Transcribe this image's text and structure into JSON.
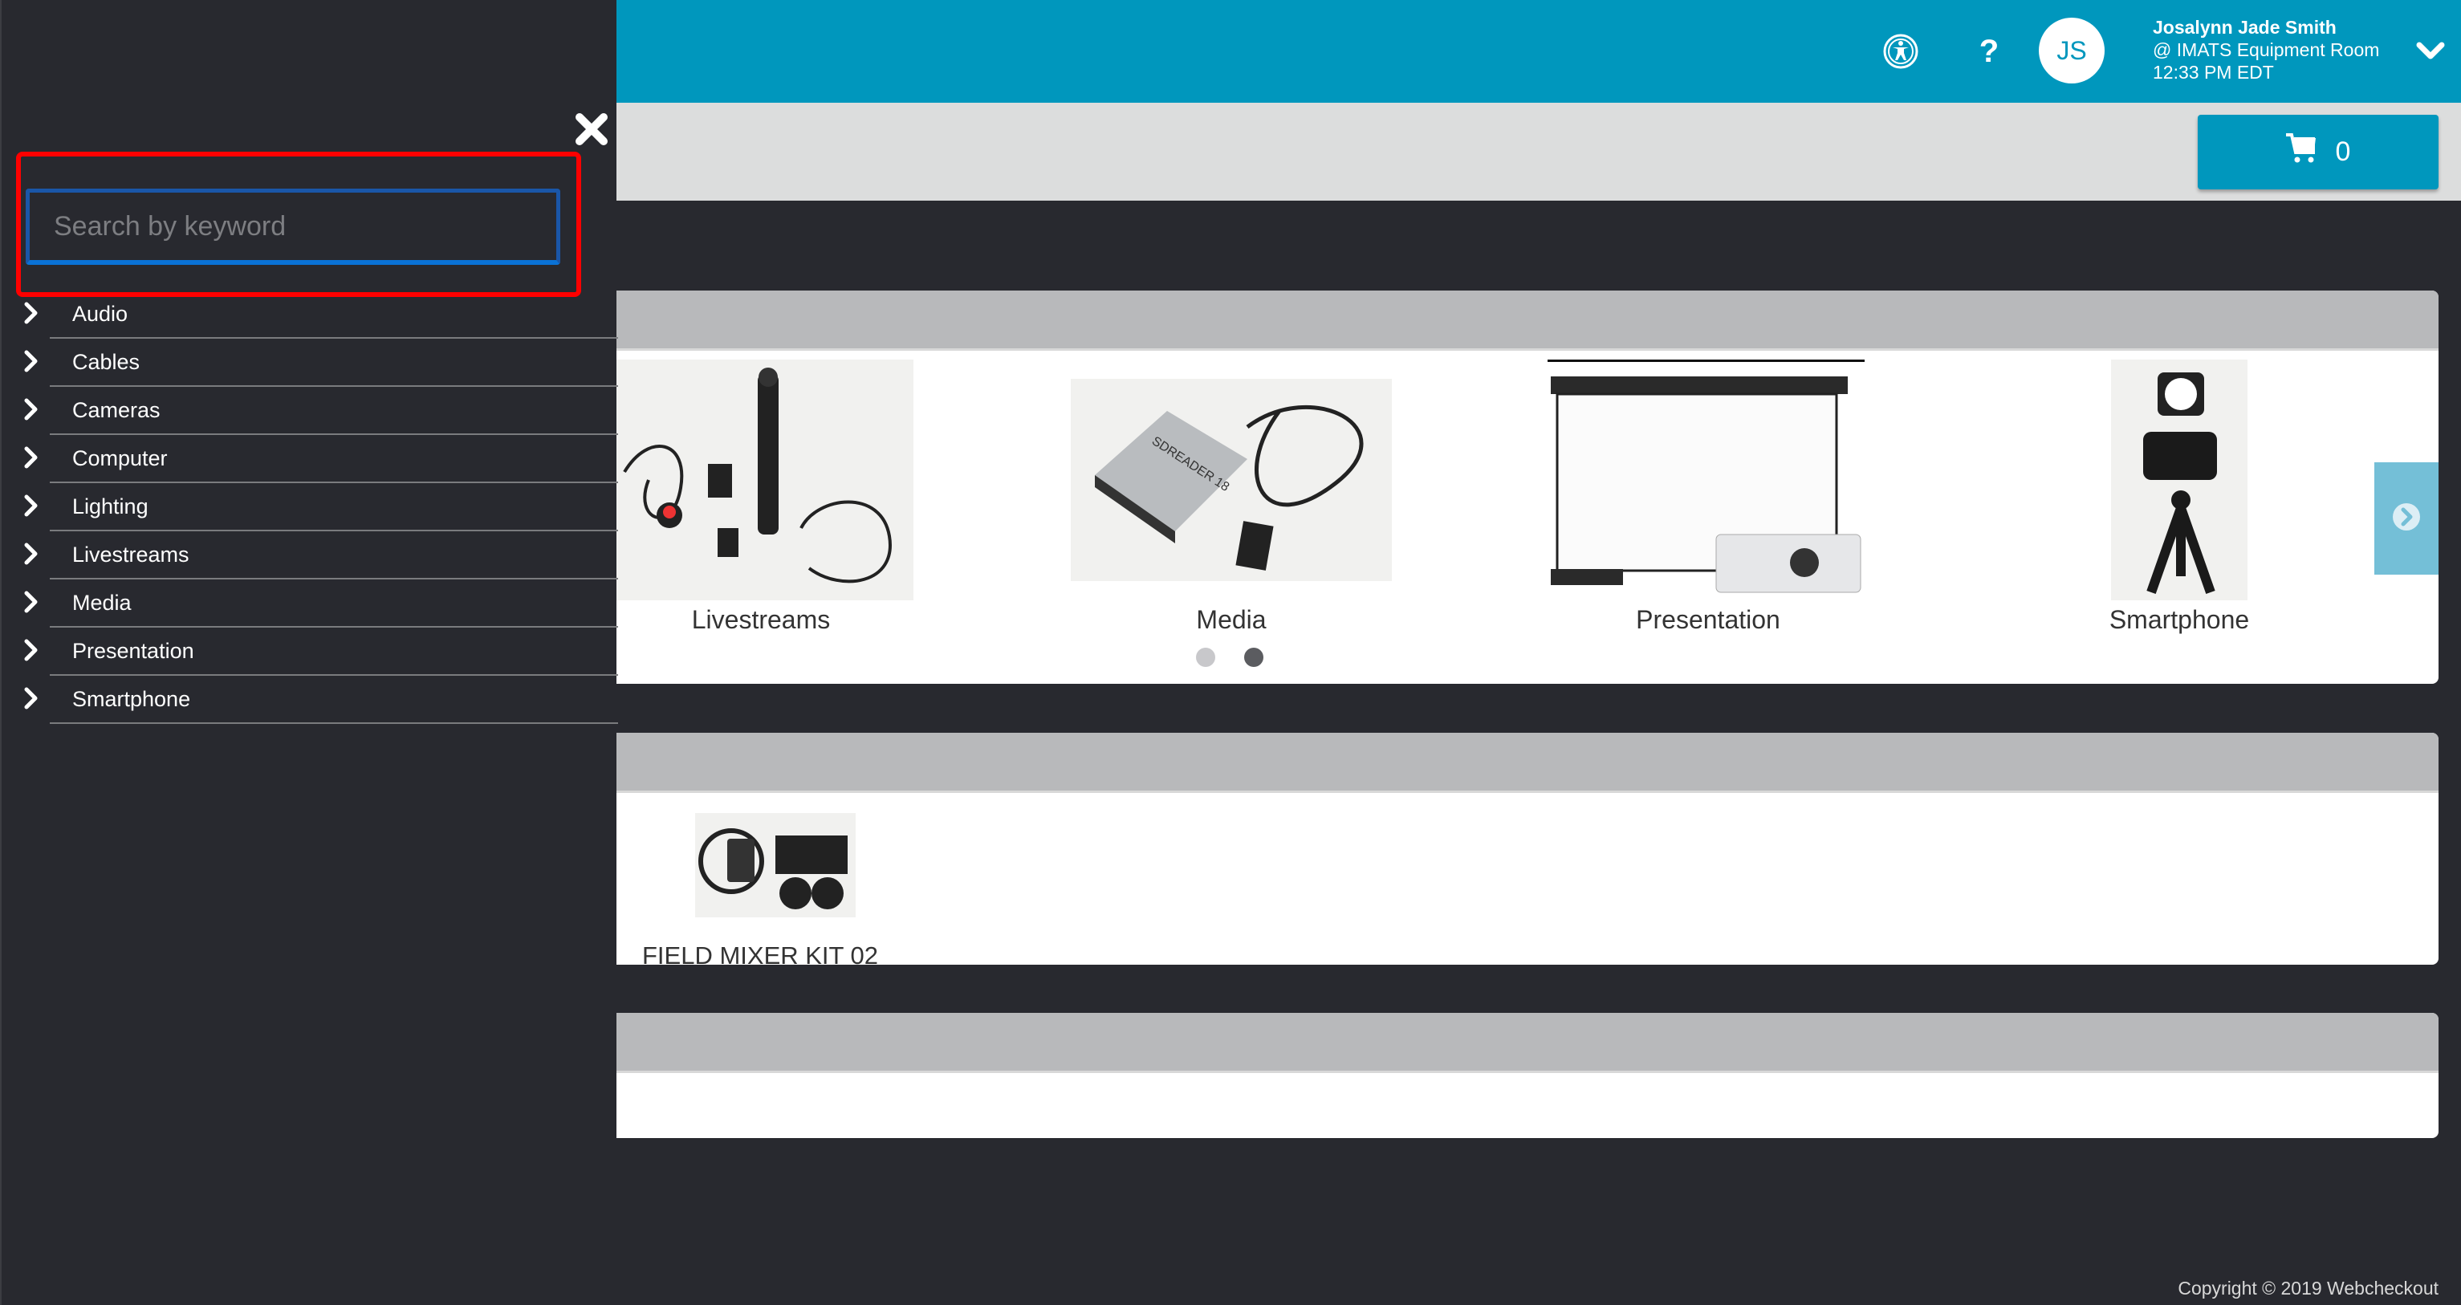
{
  "header": {
    "accessibility_icon": "accessibility-icon",
    "help_label": "?",
    "avatar_initials": "JS",
    "user_name": "Josalynn Jade Smith",
    "location": "@ IMATS Equipment Room",
    "time": "12:33 PM EDT",
    "brand_color": "#0097bd"
  },
  "toolbar": {
    "cart_count": "0",
    "cart_icon": "cart-icon"
  },
  "sidebar": {
    "search_placeholder": "Search by keyword",
    "search_value": "",
    "close_icon": "close-icon",
    "items": [
      {
        "label": "Audio"
      },
      {
        "label": "Cables"
      },
      {
        "label": "Cameras"
      },
      {
        "label": "Computer"
      },
      {
        "label": "Lighting"
      },
      {
        "label": "Livestreams"
      },
      {
        "label": "Media"
      },
      {
        "label": "Presentation"
      },
      {
        "label": "Smartphone"
      }
    ]
  },
  "categories_carousel": {
    "items": [
      {
        "label": "Livestreams"
      },
      {
        "label": "Media"
      },
      {
        "label": "Presentation"
      },
      {
        "label": "Smartphone"
      }
    ],
    "page_count": 2,
    "active_page": 2
  },
  "featured": {
    "items": [
      {
        "label": "FIELD MIXER KIT 02"
      }
    ]
  },
  "footer": {
    "copyright": "Copyright © 2019 Webcheckout"
  }
}
